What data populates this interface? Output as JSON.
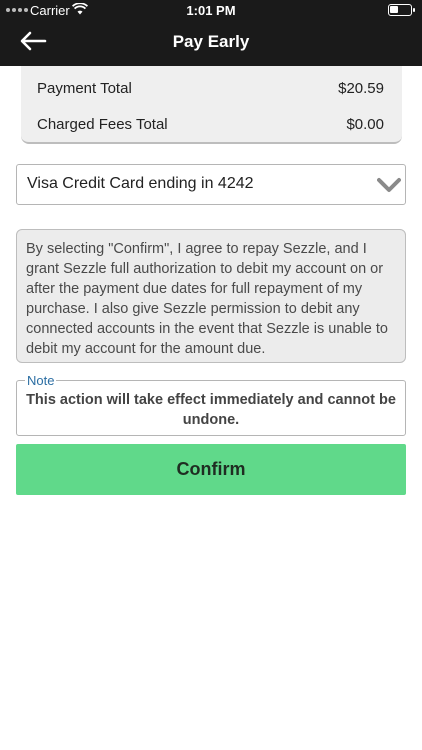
{
  "status_bar": {
    "carrier": "Carrier",
    "time": "1:01 PM"
  },
  "nav": {
    "title": "Pay Early",
    "back_icon": "arrow-left-icon"
  },
  "summary": {
    "payment_total_label": "Payment Total",
    "payment_total_value": "$20.59",
    "fees_label": "Charged Fees Total",
    "fees_value": "$0.00"
  },
  "payment_method": {
    "selected": "Visa  Credit Card ending in 4242",
    "icon": "chevron-down-icon"
  },
  "terms": {
    "text": "By selecting \"Confirm\", I agree to repay Sezzle, and I grant Sezzle full authorization to debit my account on or after the payment due dates for full repayment of my purchase. I also give Sezzle permission to debit any connected accounts in the event that Sezzle is unable to debit my account for the amount due."
  },
  "note": {
    "label": "Note",
    "text": "This action will take effect immediately and cannot be undone."
  },
  "actions": {
    "confirm_label": "Confirm"
  },
  "colors": {
    "header": "#1a1a1a",
    "confirm": "#60d98a",
    "note_label": "#2b6ea3"
  }
}
